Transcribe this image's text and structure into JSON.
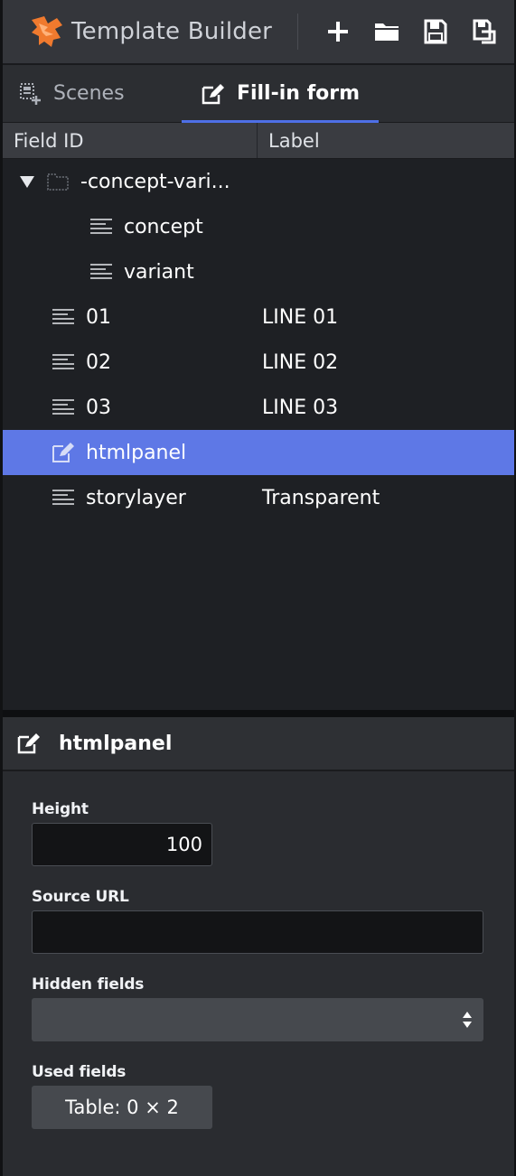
{
  "app": {
    "title": "Template Builder"
  },
  "toolbar": {
    "new_icon": "plus-icon",
    "open_icon": "folder-icon",
    "save_icon": "save-icon",
    "save_as_icon": "save-as-icon"
  },
  "tabs": [
    {
      "label": "Scenes",
      "icon": "scenes-icon",
      "active": false
    },
    {
      "label": "Fill-in form",
      "icon": "edit-form-icon",
      "active": true
    }
  ],
  "columns": {
    "field_id": "Field ID",
    "label": "Label"
  },
  "tree": [
    {
      "id": "-concept-vari...",
      "label": "",
      "type": "folder",
      "expanded": true
    },
    {
      "id": "concept",
      "label": "",
      "type": "text",
      "child": true
    },
    {
      "id": "variant",
      "label": "",
      "type": "text",
      "child": true
    },
    {
      "id": "01",
      "label": "LINE 01",
      "type": "text"
    },
    {
      "id": "02",
      "label": "LINE 02",
      "type": "text"
    },
    {
      "id": "03",
      "label": "LINE 03",
      "type": "text"
    },
    {
      "id": "htmlpanel",
      "label": "",
      "type": "html",
      "selected": true
    },
    {
      "id": "storylayer",
      "label": "Transparent",
      "type": "text"
    }
  ],
  "detail": {
    "title": "htmlpanel",
    "height_label": "Height",
    "height_value": "100",
    "source_url_label": "Source URL",
    "source_url_value": "",
    "hidden_fields_label": "Hidden fields",
    "hidden_fields_value": "",
    "used_fields_label": "Used fields",
    "used_fields_button": "Table: 0 × 2"
  },
  "colors": {
    "accent": "#5e78e6",
    "tab_underline": "#4e6fe6",
    "logo": "#f07a2e"
  }
}
